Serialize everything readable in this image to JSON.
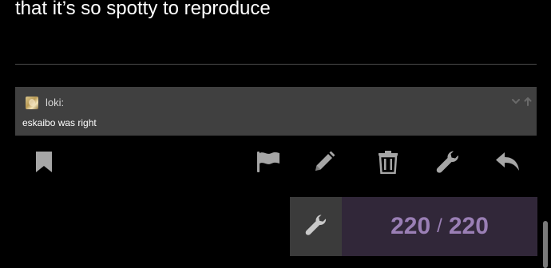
{
  "post": {
    "text": "that it’s so spotty to reproduce"
  },
  "quote": {
    "username": "loki:",
    "body": "eskaibo was right",
    "avatar_icon": "user-avatar",
    "controls": [
      "chevron-down-icon",
      "arrow-up-icon"
    ]
  },
  "actions": [
    "bookmark-icon",
    "flag-icon",
    "pencil-icon",
    "trash-icon",
    "wrench-icon",
    "reply-icon"
  ],
  "progress": {
    "current": "220",
    "separator": "/",
    "total": "220",
    "tool_icon": "wrench-icon"
  },
  "colors": {
    "background": "#000000",
    "quote_bg": "#404040",
    "icon": "#a6a6a6",
    "progress_bg": "#312739",
    "progress_text": "#9a7fb5",
    "tool_bg": "#3b3b3b"
  }
}
